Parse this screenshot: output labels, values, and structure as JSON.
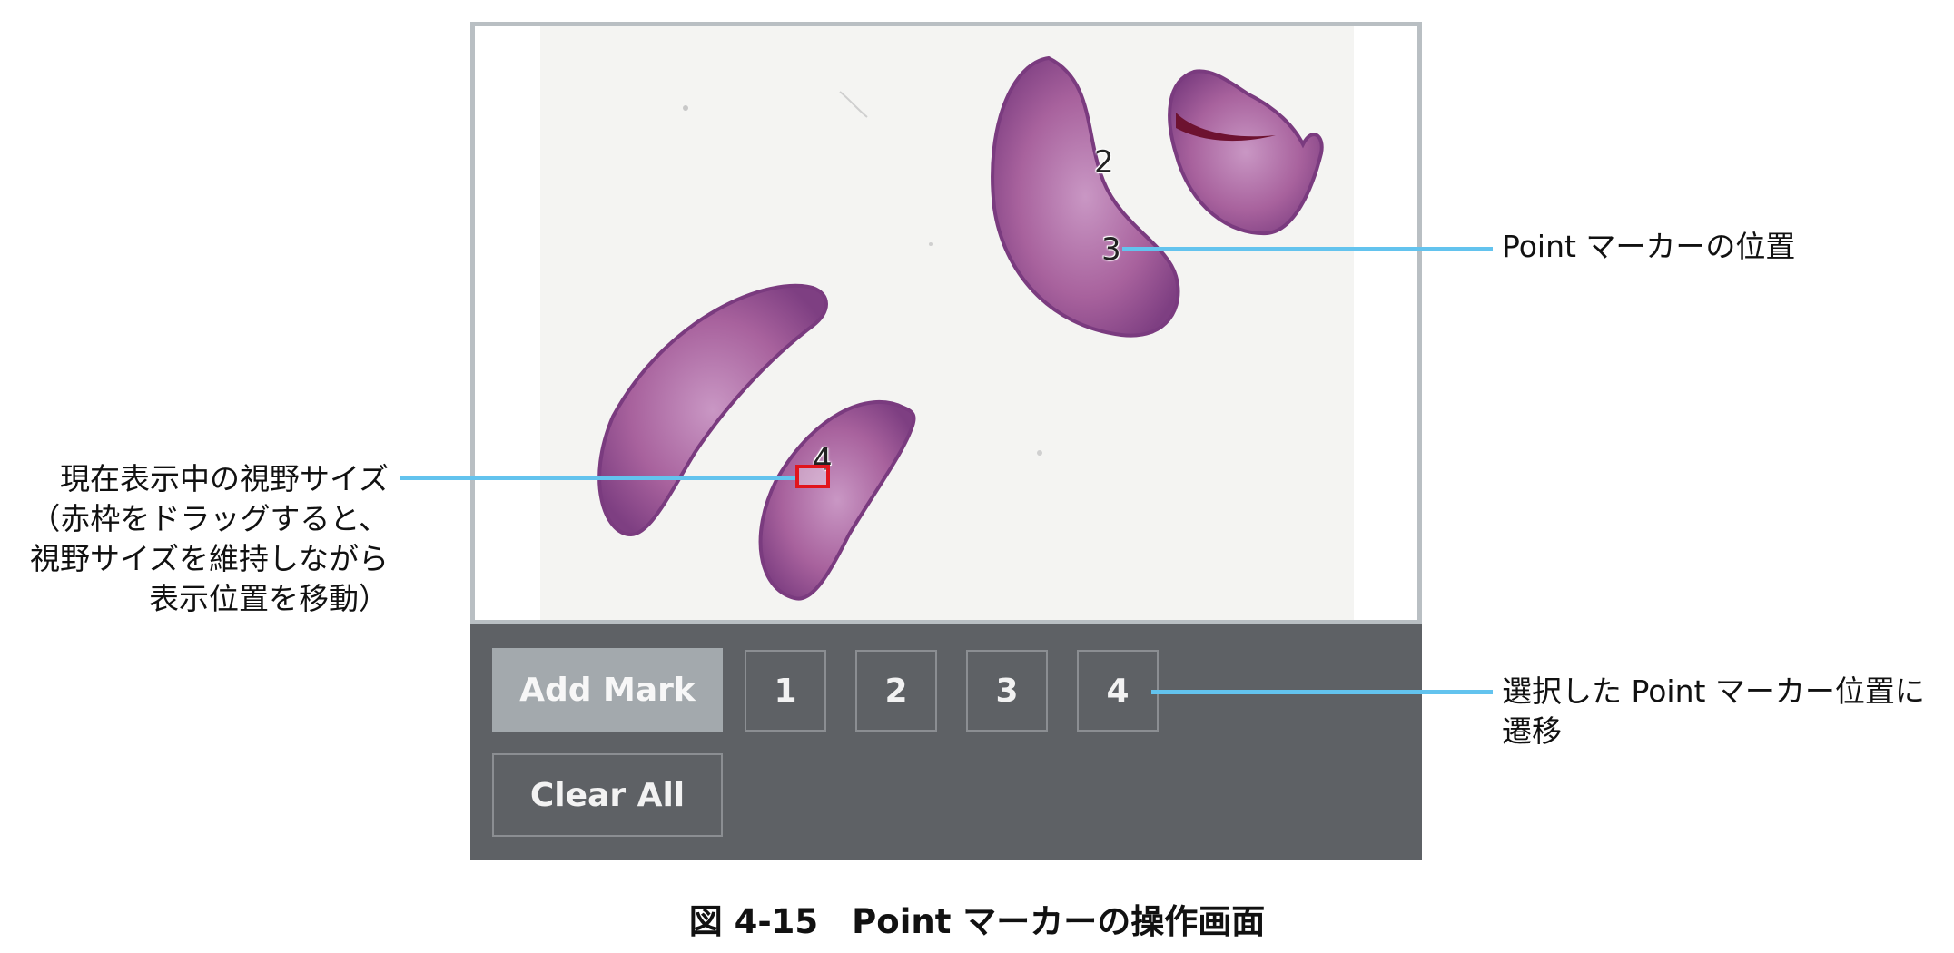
{
  "viewer": {
    "markers": [
      "2",
      "3",
      "4"
    ]
  },
  "buttons": {
    "add_mark": "Add Mark",
    "points": [
      "1",
      "2",
      "3",
      "4"
    ],
    "clear_all": "Clear All"
  },
  "callouts": {
    "left_lines": [
      "現在表示中の視野サイズ",
      "（赤枠をドラッグすると、",
      "視野サイズを維持しながら",
      "表示位置を移動）"
    ],
    "right_top": "Point マーカーの位置",
    "right_bottom_lines": [
      "選択した Point マーカー位置に",
      "遷移"
    ]
  },
  "caption": "図 4-15　Point マーカーの操作画面",
  "colors": {
    "panel_bg": "#5e6165",
    "add_mark_bg": "#a3a9ad",
    "callout_line": "#63c3ee",
    "viewport_box": "#e1151d",
    "tissue": "#a8629d"
  }
}
